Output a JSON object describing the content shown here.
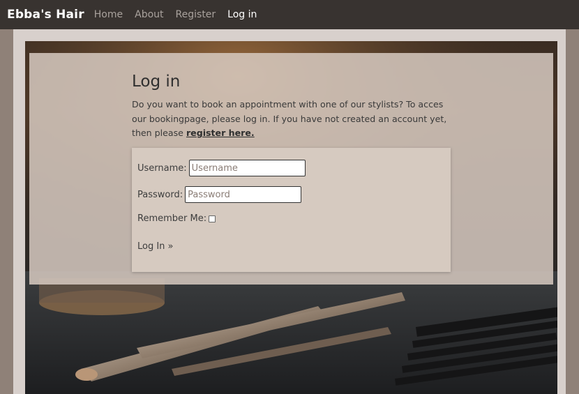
{
  "nav": {
    "brand": "Ebba's Hair",
    "links": [
      {
        "label": "Home"
      },
      {
        "label": "About"
      },
      {
        "label": "Register"
      },
      {
        "label": "Log in"
      }
    ]
  },
  "login": {
    "title": "Log in",
    "intro": "Do you want to book an appointment with one of our stylists? To acces our bookingpage, please log in. If you have not created an account yet, then please",
    "register_link": "register here.",
    "username_label": "Username:",
    "username_placeholder": "Username",
    "password_label": "Password:",
    "password_placeholder": "Password",
    "remember_label": "Remember Me:",
    "remember_checked": false,
    "submit_label": "Log In »"
  }
}
